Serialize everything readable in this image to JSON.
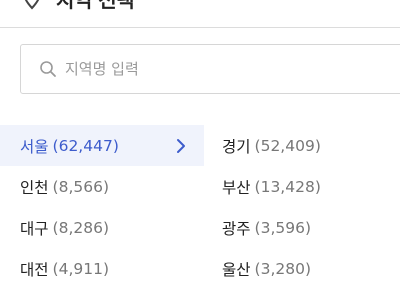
{
  "header": {
    "title": "지역 선택"
  },
  "search": {
    "placeholder": "지역명 입력",
    "value": ""
  },
  "regions": {
    "left": [
      {
        "name": "서울",
        "count": "(62,447)",
        "selected": true
      },
      {
        "name": "인천",
        "count": "(8,566)"
      },
      {
        "name": "대구",
        "count": "(8,286)"
      },
      {
        "name": "대전",
        "count": "(4,911)"
      }
    ],
    "right": [
      {
        "name": "경기",
        "count": "(52,409)"
      },
      {
        "name": "부산",
        "count": "(13,428)"
      },
      {
        "name": "광주",
        "count": "(3,596)"
      },
      {
        "name": "울산",
        "count": "(3,280)"
      }
    ]
  },
  "colors": {
    "accent": "#3d5ccc",
    "selected_bg": "#f0f3fc"
  },
  "icons": {
    "header": "location-pin-icon",
    "search": "search-icon",
    "selected_arrow": "chevron-right-icon"
  }
}
